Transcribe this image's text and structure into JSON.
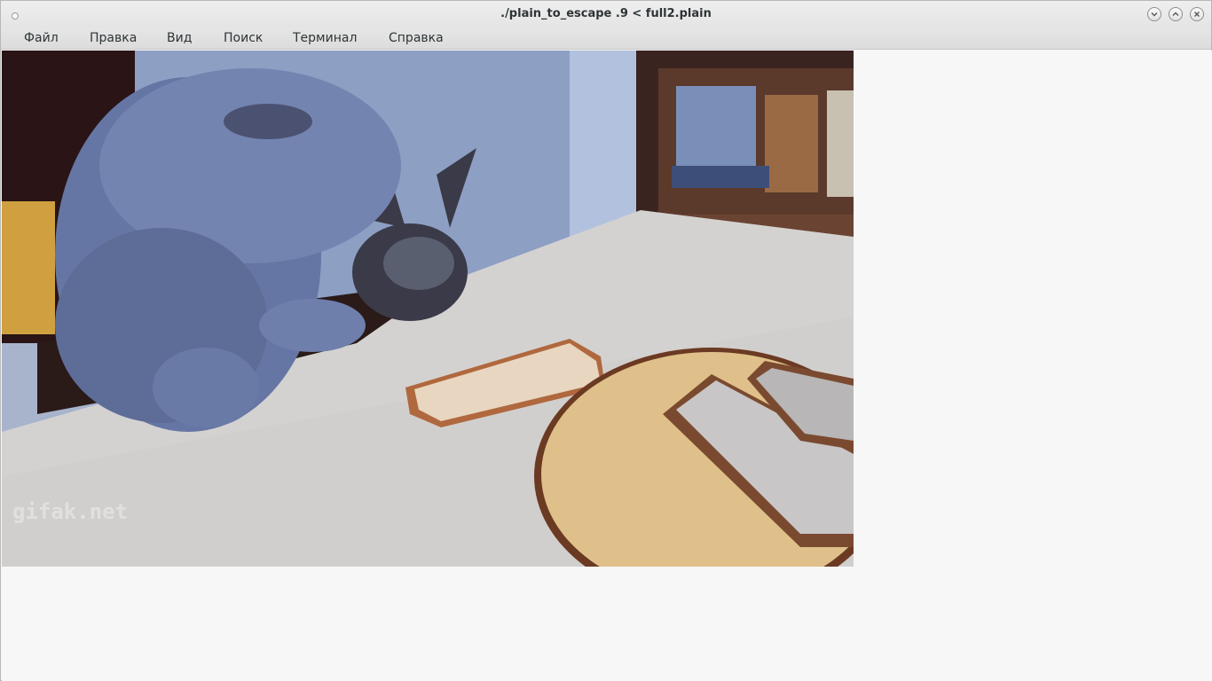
{
  "window": {
    "title": "./plain_to_escape .9 < full2.plain",
    "controls": [
      {
        "name": "minimize-button",
        "icon": "chevron-down-icon"
      },
      {
        "name": "maximize-button",
        "icon": "chevron-up-icon"
      },
      {
        "name": "close-button",
        "icon": "close-icon"
      }
    ]
  },
  "menu": {
    "file": "Файл",
    "edit": "Правка",
    "view": "Вид",
    "search": "Поиск",
    "terminal": "Терминал",
    "help": "Справка"
  },
  "terminal_output": {
    "picture_subject": "grey cat reaching for bread slices on a table",
    "watermark": "gifak.net"
  },
  "colors": {
    "titlebar": "#e8e8e8",
    "menubar": "#e0e0e0",
    "background": "#f7f7f7",
    "text": "#2e3436"
  }
}
